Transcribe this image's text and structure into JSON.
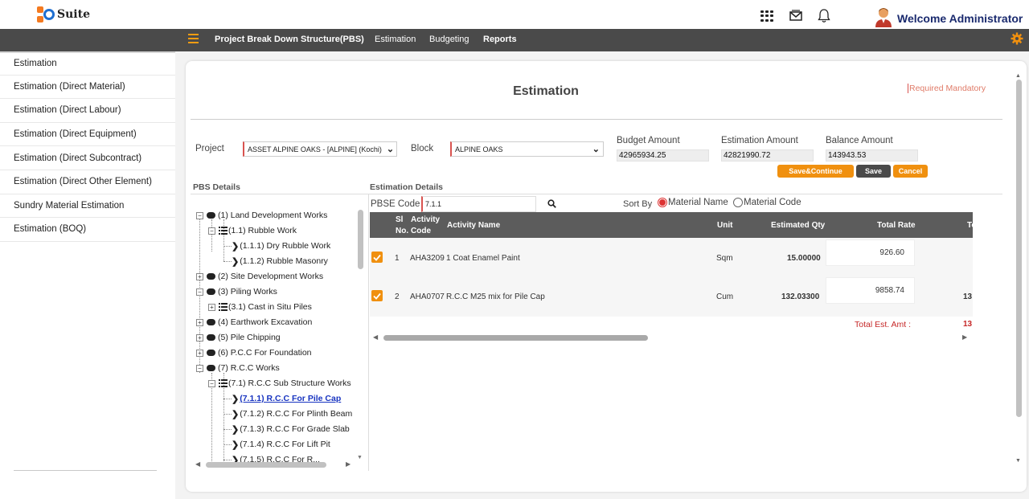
{
  "brand": {
    "name": "Suite"
  },
  "header": {
    "welcome": "Welcome Administrator"
  },
  "nav": {
    "items": [
      {
        "label": "Project Break Down Structure(PBS)"
      },
      {
        "label": "Estimation"
      },
      {
        "label": "Budgeting"
      },
      {
        "label": "Reports"
      }
    ]
  },
  "sidebar": {
    "items": [
      {
        "label": "Estimation"
      },
      {
        "label": "Estimation (Direct Material)"
      },
      {
        "label": "Estimation (Direct Labour)"
      },
      {
        "label": "Estimation (Direct Equipment)"
      },
      {
        "label": "Estimation (Direct Subcontract)"
      },
      {
        "label": "Estimation (Direct Other Element)"
      },
      {
        "label": "Sundry Material Estimation"
      },
      {
        "label": "Estimation (BOQ)"
      }
    ]
  },
  "page": {
    "title": "Estimation",
    "required_note": "Required Mandatory"
  },
  "form": {
    "project_label": "Project",
    "project_value": "ASSET ALPINE OAKS - [ALPINE] (Kochi)",
    "block_label": "Block",
    "block_value": "ALPINE OAKS",
    "budget_amount_label": "Budget Amount",
    "budget_amount": "42965934.25",
    "estimation_amount_label": "Estimation Amount",
    "estimation_amount": "42821990.72",
    "balance_amount_label": "Balance Amount",
    "balance_amount": "143943.53"
  },
  "buttons": {
    "save_continue": "Save&Continue",
    "save": "Save",
    "cancel": "Cancel"
  },
  "pbs": {
    "title": "PBS Details",
    "nodes": [
      {
        "label": "(1) Land Development Works"
      },
      {
        "label": "(1.1) Rubble Work"
      },
      {
        "label": "(1.1.1) Dry Rubble Work"
      },
      {
        "label": "(1.1.2) Rubble Masonry"
      },
      {
        "label": "(2) Site Development Works"
      },
      {
        "label": "(3) Piling Works"
      },
      {
        "label": "(3.1) Cast in Situ Piles"
      },
      {
        "label": "(4) Earthwork Excavation"
      },
      {
        "label": "(5) Pile Chipping"
      },
      {
        "label": "(6) P.C.C For Foundation"
      },
      {
        "label": "(7) R.C.C Works"
      },
      {
        "label": "(7.1) R.C.C Sub Structure Works"
      },
      {
        "label": "(7.1.1) R.C.C For Pile Cap"
      },
      {
        "label": "(7.1.2) R.C.C For Plinth Beam"
      },
      {
        "label": "(7.1.3) R.C.C For Grade Slab"
      },
      {
        "label": "(7.1.4) R.C.C For Lift Pit"
      },
      {
        "label": "(7.1.5) R.C.C For R..."
      }
    ]
  },
  "estimation": {
    "title": "Estimation Details",
    "pbse_label": "PBSE Code",
    "pbse_value": "7.1.1",
    "sort_by_label": "Sort By",
    "sort_options": [
      {
        "label": "Material Name",
        "selected": true
      },
      {
        "label": "Material Code",
        "selected": false
      }
    ],
    "columns": {
      "sl": "Sl",
      "no": "No.",
      "activity": "Activity",
      "code": "Code",
      "activity_name": "Activity Name",
      "unit": "Unit",
      "estimated_qty": "Estimated Qty",
      "total_rate": "Total Rate",
      "extra": "To"
    },
    "rows": [
      {
        "sl": "1",
        "code": "AHA3209",
        "name": "1 Coat Enamel Paint",
        "unit": "Sqm",
        "qty": "15.00000",
        "rate": "926.60",
        "extra": ""
      },
      {
        "sl": "2",
        "code": "AHA0707",
        "name": "R.C.C M25 mix for Pile Cap",
        "unit": "Cum",
        "qty": "132.03300",
        "rate": "9858.74",
        "extra": "13"
      }
    ],
    "total_label": "Total Est. Amt :",
    "total_value": "13"
  },
  "colors": {
    "accent": "#f0900f",
    "navbar": "#4a4a4a",
    "mandatory": "#d9534f",
    "link": "#1733c0"
  }
}
